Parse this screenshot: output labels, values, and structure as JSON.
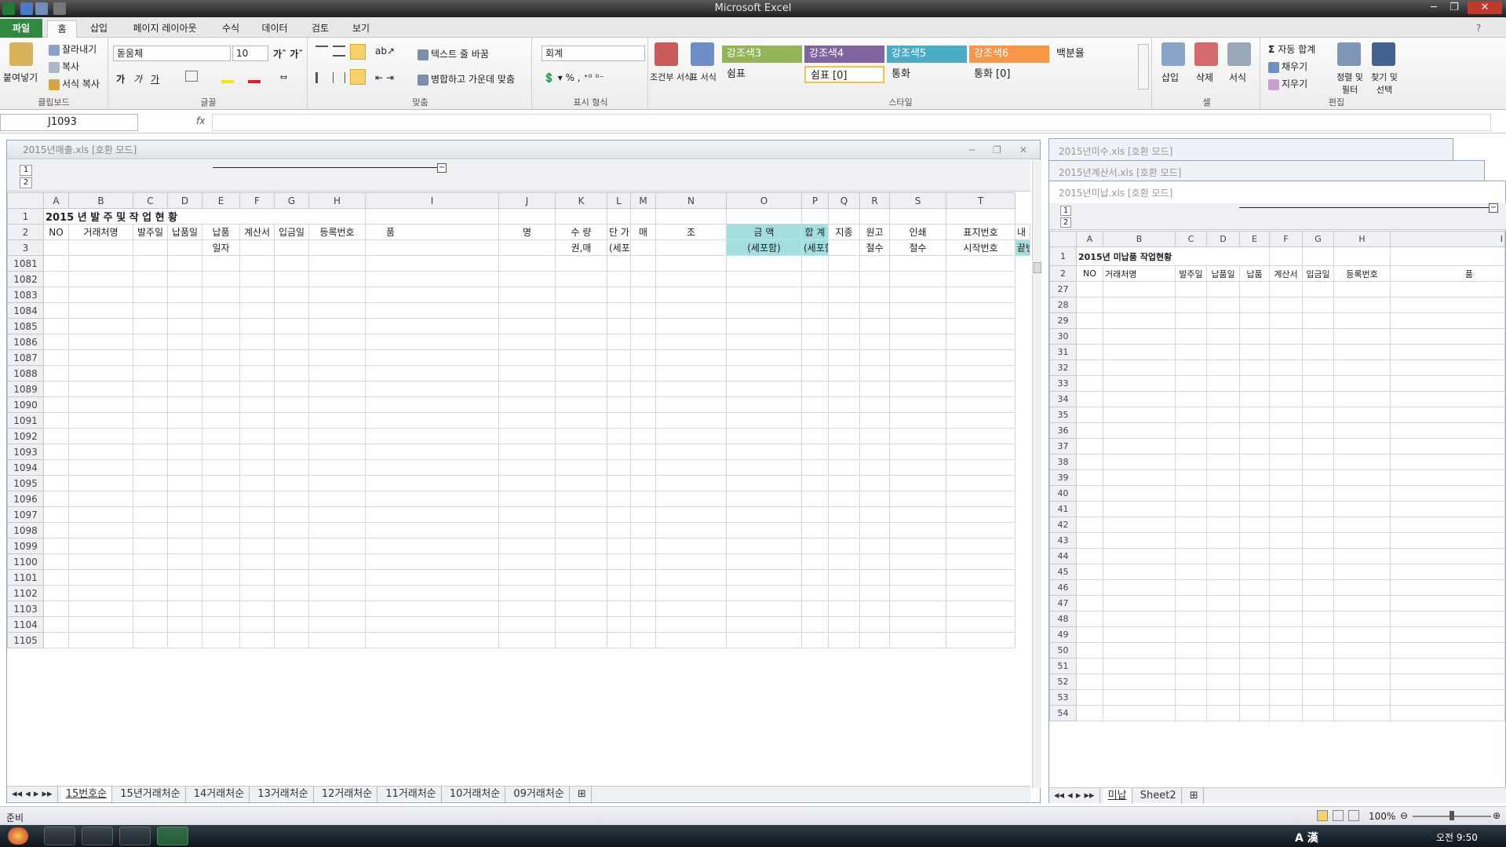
{
  "app_title": "Microsoft Excel",
  "tabs": [
    "파일",
    "홈",
    "삽입",
    "페이지 레이아웃",
    "수식",
    "데이터",
    "검토",
    "보기"
  ],
  "ribbon": {
    "clipboard": {
      "paste": "붙여넣기",
      "cut": "잘라내기",
      "copy": "복사",
      "format_painter": "서식 복사",
      "label": "클립보드"
    },
    "font": {
      "name": "돋움체",
      "size": "10",
      "label": "글꼴"
    },
    "alignment": {
      "wrap": "텍스트 줄 바꿈",
      "merge": "병합하고 가운데 맞춤",
      "label": "맞춤"
    },
    "number": {
      "format": "회계",
      "label": "표시 형식"
    },
    "styles": {
      "conditional": "조건부 서식",
      "table": "표 서식",
      "cells": [
        "강조색3",
        "강조색4",
        "강조색5",
        "강조색6",
        "백분율",
        "쉼표",
        "쉼표 [0]",
        "통화",
        "통화 [0]"
      ],
      "label": "스타일"
    },
    "cells": {
      "insert": "삽입",
      "delete": "삭제",
      "format": "서식",
      "label": "셀"
    },
    "editing": {
      "autosum": "자동 합계",
      "fill": "채우기",
      "clear": "지우기",
      "sort": "정렬 및 필터",
      "find": "찾기 및 선택",
      "label": "편집"
    }
  },
  "name_box": "J1093",
  "formula_fx": "fx",
  "colors": {
    "cyan": "#a4dede",
    "file_tab": "#2f8a3e"
  },
  "left_window": {
    "title": "2015년매출.xls  [호환 모드]",
    "outline_levels": [
      "1",
      "2"
    ],
    "columns": [
      "A",
      "B",
      "C",
      "D",
      "E",
      "F",
      "G",
      "H",
      "I",
      "J",
      "K",
      "L",
      "M",
      "N",
      "O",
      "P",
      "Q",
      "R",
      "S",
      "T"
    ],
    "row1": "2015 년 발 주 및 작 업 현 황",
    "row2": [
      "NO",
      "거래처명",
      "발주일",
      "납품일",
      "납품",
      "계산서",
      "입금일",
      "등록번호",
      "품",
      "명",
      "수  량",
      "단  가",
      "매",
      "조",
      "금      액",
      "합      계",
      "지종",
      "원고",
      "인쇄",
      "표지번호",
      "내      지"
    ],
    "row3": [
      "일자",
      "권,매",
      "(세포함)",
      "(세포함)",
      "(세포함)",
      "절수",
      "절수",
      "시작번호",
      "끝번호"
    ],
    "row_numbers": [
      "1081",
      "1082",
      "1083",
      "1084",
      "1085",
      "1086",
      "1087",
      "1088",
      "1089",
      "1090",
      "1091",
      "1092",
      "1093",
      "1094",
      "1095",
      "1096",
      "1097",
      "1098",
      "1099",
      "1100",
      "1101",
      "1102",
      "1103",
      "1104",
      "1105"
    ],
    "sheets": [
      "15번호순",
      "15년거래처순",
      "14거래처순",
      "13거래처순",
      "12거래처순",
      "11거래처순",
      "10거래처순",
      "09거래처순"
    ]
  },
  "right_windows": {
    "back1": "2015년미수.xls  [호환 모드]",
    "back2": "2015년계산서.xls  [호환 모드]",
    "front": {
      "title": "2015년미납.xls  [호환 모드]",
      "columns": [
        "A",
        "B",
        "C",
        "D",
        "E",
        "F",
        "G",
        "H",
        "I"
      ],
      "row1": "2015년 미납품 작업현황",
      "row2": [
        "NO",
        "거래처명",
        "발주일",
        "납품일",
        "납품",
        "계산서",
        "입금일",
        "등록번호",
        "품"
      ],
      "row_numbers": [
        "27",
        "28",
        "29",
        "30",
        "31",
        "32",
        "33",
        "34",
        "35",
        "36",
        "37",
        "38",
        "39",
        "40",
        "41",
        "42",
        "43",
        "44",
        "45",
        "46",
        "47",
        "48",
        "49",
        "50",
        "51",
        "52",
        "53",
        "54"
      ],
      "sheets": [
        "미납",
        "Sheet2"
      ]
    }
  },
  "status": {
    "ready": "준비",
    "zoom": "100%"
  },
  "taskbar": {
    "ime": "A 漢",
    "clock": "오전 9:50"
  }
}
